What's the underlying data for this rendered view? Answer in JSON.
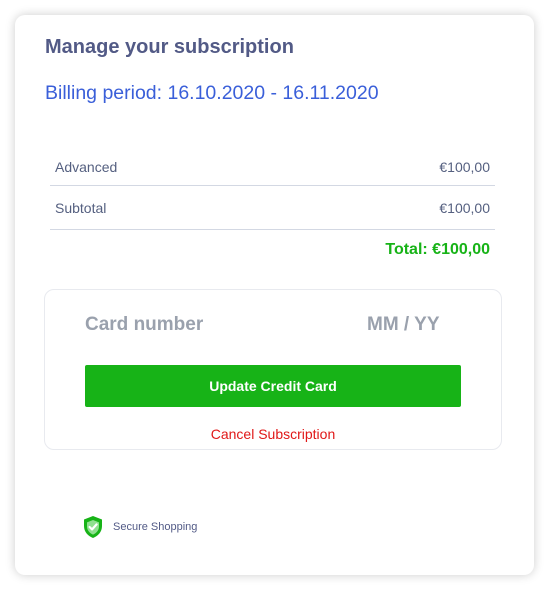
{
  "header": {
    "title": "Manage your subscription",
    "billing_period": "Billing period: 16.10.2020 - 16.11.2020"
  },
  "line_items": [
    {
      "label": "Advanced",
      "amount": "€100,00"
    },
    {
      "label": "Subtotal",
      "amount": "€100,00"
    }
  ],
  "total": "Total: €100,00",
  "payment": {
    "card_number_placeholder": "Card number",
    "expiry_placeholder": "MM / YY",
    "update_button_label": "Update Credit Card",
    "cancel_label": "Cancel Subscription"
  },
  "footer": {
    "secure_label": "Secure Shopping",
    "secure_icon": "shield-check-icon"
  },
  "colors": {
    "heading": "#525a86",
    "period": "#3a5fd9",
    "accent_green": "#17b317",
    "cancel_red": "#e01818"
  }
}
